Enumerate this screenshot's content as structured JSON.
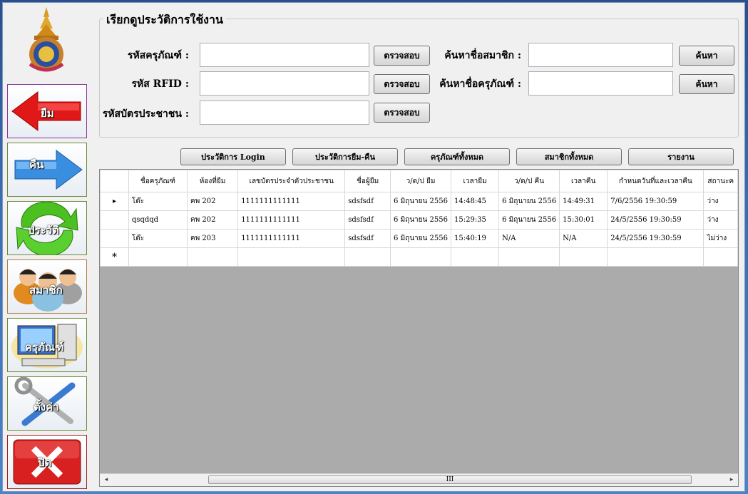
{
  "sidebar": {
    "items": [
      {
        "label": "ยืม",
        "icon": "arrow-left-icon"
      },
      {
        "label": "คืน",
        "icon": "arrow-right-icon"
      },
      {
        "label": "ประวัติ",
        "icon": "refresh-icon"
      },
      {
        "label": "สมาชิก",
        "icon": "users-icon"
      },
      {
        "label": "ครุภัณฑ์",
        "icon": "computer-icon"
      },
      {
        "label": "ตั้งค่า",
        "icon": "tools-icon"
      },
      {
        "label": "ปิด",
        "icon": "close-icon"
      }
    ]
  },
  "header": {
    "title": "เรียกดูประวัติการใช้งาน"
  },
  "form": {
    "equipment_code_label": "รหัสครุภัณฑ์ :",
    "rfid_label": "รหัส RFID :",
    "citizen_id_label": "รหัสบัตรประชาชน :",
    "check_label": "ตรวจสอบ",
    "search_member_label": "ค้นหาชื่อสมาชิก :",
    "search_equipment_label": "ค้นหาชื่อครุภัณฑ์ :",
    "search_label": "ค้นหา",
    "equipment_code_value": "",
    "rfid_value": "",
    "citizen_id_value": "",
    "search_member_value": "",
    "search_equipment_value": ""
  },
  "tabs": [
    {
      "label": "ประวัติการ Login"
    },
    {
      "label": "ประวัติการยืม-คืน"
    },
    {
      "label": "ครุภัณฑ์ทั้งหมด"
    },
    {
      "label": "สมาชิกทั้งหมด"
    },
    {
      "label": "รายงาน"
    }
  ],
  "table": {
    "columns": [
      "ชื่อครุภัณฑ์",
      "ห้องที่ยืม",
      "เลขบัตรประจำตัวประชาชน",
      "ชื่อผู้ยืม",
      "ว/ด/ป ยืม",
      "เวลายืม",
      "ว/ด/ป คืน",
      "เวลาคืน",
      "กำหนดวันที่และเวลาคืน",
      "สถานะค"
    ],
    "rows": [
      {
        "marker": "▸",
        "cells": [
          "โต๊ะ",
          "คพ 202",
          "1111111111111",
          "sdsfsdf",
          "6 มิถุนายน 2556",
          "14:48:45",
          "6 มิถุนายน 2556",
          "14:49:31",
          "7/6/2556 19:30:59",
          "ว่าง"
        ]
      },
      {
        "marker": "",
        "cells": [
          "qsqdqd",
          "คพ 202",
          "1111111111111",
          "sdsfsdf",
          "6 มิถุนายน 2556",
          "15:29:35",
          "6 มิถุนายน 2556",
          "15:30:01",
          "24/5/2556 19:30:59",
          "ว่าง"
        ]
      },
      {
        "marker": "",
        "cells": [
          "โต๊ะ",
          "คพ 203",
          "1111111111111",
          "sdsfsdf",
          "6 มิถุนายน 2556",
          "15:40:19",
          "N/A",
          "N/A",
          "24/5/2556 19:30:59",
          "ไม่ว่าง"
        ]
      }
    ],
    "new_row_marker": "*"
  },
  "scrollbar": {
    "thumb_grip": "III",
    "left_arrow": "◂",
    "right_arrow": "▸"
  }
}
